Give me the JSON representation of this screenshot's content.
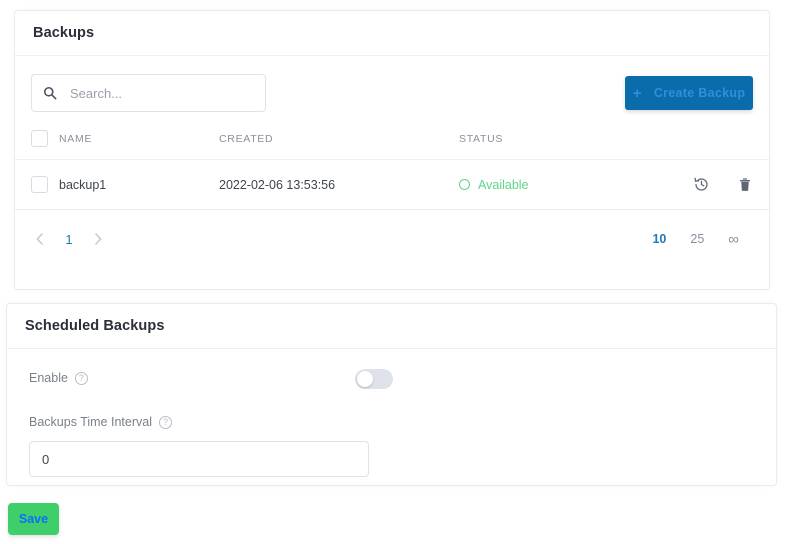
{
  "backups_card": {
    "title": "Backups",
    "search": {
      "placeholder": "Search...",
      "value": "",
      "icon": "search-icon"
    },
    "create_button": {
      "label": "Create Backup",
      "icon": "plus-icon",
      "bg_color": "#0b6cab",
      "text_color": "#2e8fe0"
    },
    "table": {
      "columns": [
        "NAME",
        "CREATED",
        "STATUS"
      ],
      "rows": [
        {
          "checked": false,
          "name": "backup1",
          "created": "2022-02-06 13:53:56",
          "status": "Available",
          "status_color": "#5ed48a",
          "actions": [
            "restore-icon",
            "delete-icon"
          ]
        }
      ]
    },
    "pagination": {
      "prev_icon": "chevron-left-icon",
      "next_icon": "chevron-right-icon",
      "current_page": "1",
      "page_sizes": [
        "10",
        "25",
        "∞"
      ],
      "active_page_size": "10",
      "active_color": "#1f7ab5"
    }
  },
  "scheduled_card": {
    "title": "Scheduled Backups",
    "enable": {
      "label": "Enable",
      "help_icon": "help-circle-icon",
      "help_glyph": "?",
      "toggle_on": false
    },
    "interval": {
      "label": "Backups Time Interval",
      "help_icon": "help-circle-icon",
      "help_glyph": "?",
      "value": "0"
    }
  },
  "save_button": {
    "label": "Save",
    "bg_color": "#3ecf6a",
    "text_color": "#0d6efd"
  }
}
